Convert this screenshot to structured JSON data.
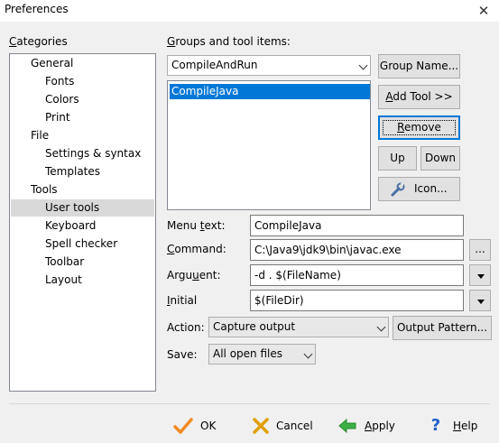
{
  "window": {
    "title": "Preferences",
    "close_glyph": "✕"
  },
  "categories": {
    "label": "Categories",
    "items": [
      {
        "label": "General",
        "level": 1
      },
      {
        "label": "Fonts",
        "level": 2
      },
      {
        "label": "Colors",
        "level": 2
      },
      {
        "label": "Print",
        "level": 2
      },
      {
        "label": "File",
        "level": 1
      },
      {
        "label": "Settings & syntax",
        "level": 2
      },
      {
        "label": "Templates",
        "level": 2
      },
      {
        "label": "Tools",
        "level": 1
      },
      {
        "label": "User tools",
        "level": 2,
        "selected": true
      },
      {
        "label": "Keyboard",
        "level": 2
      },
      {
        "label": "Spell checker",
        "level": 2
      },
      {
        "label": "Toolbar",
        "level": 2
      },
      {
        "label": "Layout",
        "level": 2
      }
    ]
  },
  "groups": {
    "label": "Groups and tool items:",
    "selected_group": "CompileAndRun",
    "tool_items": [
      "CompileJava"
    ],
    "group_name_button": "Group Name...",
    "add_tool_button": "Add Tool >>",
    "remove_button": "Remove",
    "up_button": "Up",
    "down_button": "Down",
    "icon_button": "Icon..."
  },
  "form": {
    "menu_text_label": "Menu text:",
    "menu_text_value": "CompileJava",
    "command_label": "Command:",
    "command_value": "C:\\Java9\\jdk9\\bin\\javac.exe",
    "browse_label": "...",
    "argument_label": "Argument:",
    "argument_value": "-d . $(FileName)",
    "initial_label": "Initial",
    "initial_value": "$(FileDir)",
    "action_label": "Action:",
    "action_value": "Capture output",
    "output_pattern_button": "Output Pattern...",
    "save_label": "Save:",
    "save_value": "All open files"
  },
  "footer": {
    "ok": "OK",
    "cancel": "Cancel",
    "apply": "Apply",
    "help": "Help",
    "colors": {
      "ok_check": "#f08a24",
      "cancel_x": "#e0a000",
      "apply_arrow": "#3cb043",
      "help_q": "#1e5fc8"
    }
  },
  "colors": {
    "selection": "#0078d7",
    "tree_selection": "#d9d9d9"
  }
}
